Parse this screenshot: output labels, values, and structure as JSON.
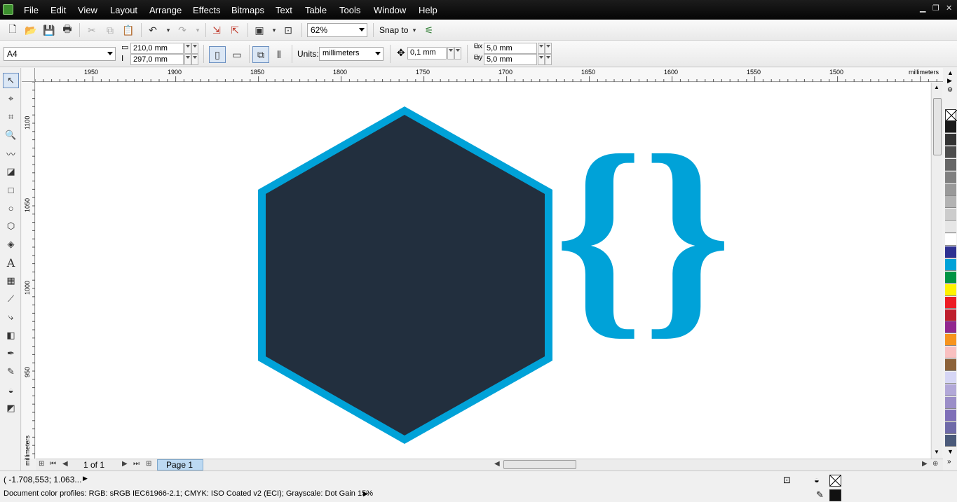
{
  "menubar": {
    "items": [
      "File",
      "Edit",
      "View",
      "Layout",
      "Arrange",
      "Effects",
      "Bitmaps",
      "Text",
      "Table",
      "Tools",
      "Window",
      "Help"
    ]
  },
  "toolbar": {
    "zoom": "62%",
    "snap_label": "Snap to"
  },
  "property_bar": {
    "page_size": "A4",
    "width": "210,0 mm",
    "height": "297,0 mm",
    "units_label": "Units:",
    "units_value": "millimeters",
    "nudge": "0,1 mm",
    "dup_x": "5,0 mm",
    "dup_y": "5,0 mm"
  },
  "ruler_top": {
    "labels": [
      "1950",
      "1900",
      "1850",
      "1800",
      "1750",
      "1700",
      "1650",
      "1600",
      "1550",
      "1500"
    ],
    "unit": "millimeters"
  },
  "ruler_left": {
    "labels": [
      "1100",
      "1050",
      "1000",
      "950"
    ],
    "unit": "millimeters"
  },
  "canvas": {
    "hexagon_fill": "#222f3e",
    "hexagon_stroke": "#00a2d8",
    "braces_text": "{}",
    "braces_color": "#00a2d8"
  },
  "pagebar": {
    "page_count": "1 of 1",
    "page_tab": "Page 1"
  },
  "palette": {
    "colors": [
      "#1a1a1a",
      "#333333",
      "#4d4d4d",
      "#666666",
      "#808080",
      "#999999",
      "#b3b3b3",
      "#cccccc",
      "#e6e6e6",
      "#ffffff",
      "#2e3192",
      "#00a2d8",
      "#009444",
      "#fff200",
      "#ed1c24",
      "#be1e2d",
      "#92278f",
      "#f7941d",
      "#f9c0c0",
      "#8c6239",
      "#d6d6f5",
      "#b2a8d8",
      "#9b8ec8",
      "#7f6fb8",
      "#6f6aa8",
      "#4b5a7a"
    ]
  },
  "statusbar": {
    "coordinates": "( -1.708,553; 1.063...",
    "color_profiles": "Document color profiles: RGB: sRGB IEC61966-2.1; CMYK: ISO Coated v2 (ECI); Grayscale: Dot Gain 15%"
  }
}
